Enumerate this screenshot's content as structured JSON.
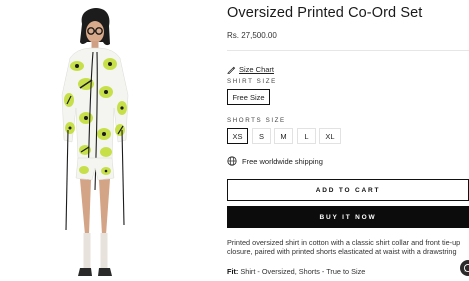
{
  "product": {
    "title": "Oversized Printed Co-Ord Set",
    "price": "Rs. 27,500.00",
    "image_alt": "model wearing oversized printed co-ord set"
  },
  "size_chart": {
    "label": "Size Chart",
    "icon": "ruler-pencil-icon"
  },
  "shirt_size": {
    "label": "SHIRT SIZE",
    "options": [
      "Free Size"
    ],
    "selected": "Free Size"
  },
  "shorts_size": {
    "label": "SHORTS SIZE",
    "options": [
      "XS",
      "S",
      "M",
      "L",
      "XL"
    ],
    "selected": "XS"
  },
  "shipping": {
    "text": "Free worldwide shipping",
    "icon": "globe-icon"
  },
  "buttons": {
    "add_to_cart": "ADD TO CART",
    "buy_now": "BUY IT NOW"
  },
  "description": "Printed oversized shirt in cotton with a classic shirt collar and front tie-up closure, paired with printed shorts elasticated at waist with a drawstring",
  "fit": {
    "label": "Fit:",
    "text": "Shirt - Oversized, Shorts - True to Size"
  },
  "whatsapp": {
    "icon": "whatsapp-icon"
  },
  "colors": {
    "primary": "#0c0c0c",
    "print_green": "#c7e04a",
    "print_black": "#1b1b1b",
    "border": "#e2e2e2"
  }
}
